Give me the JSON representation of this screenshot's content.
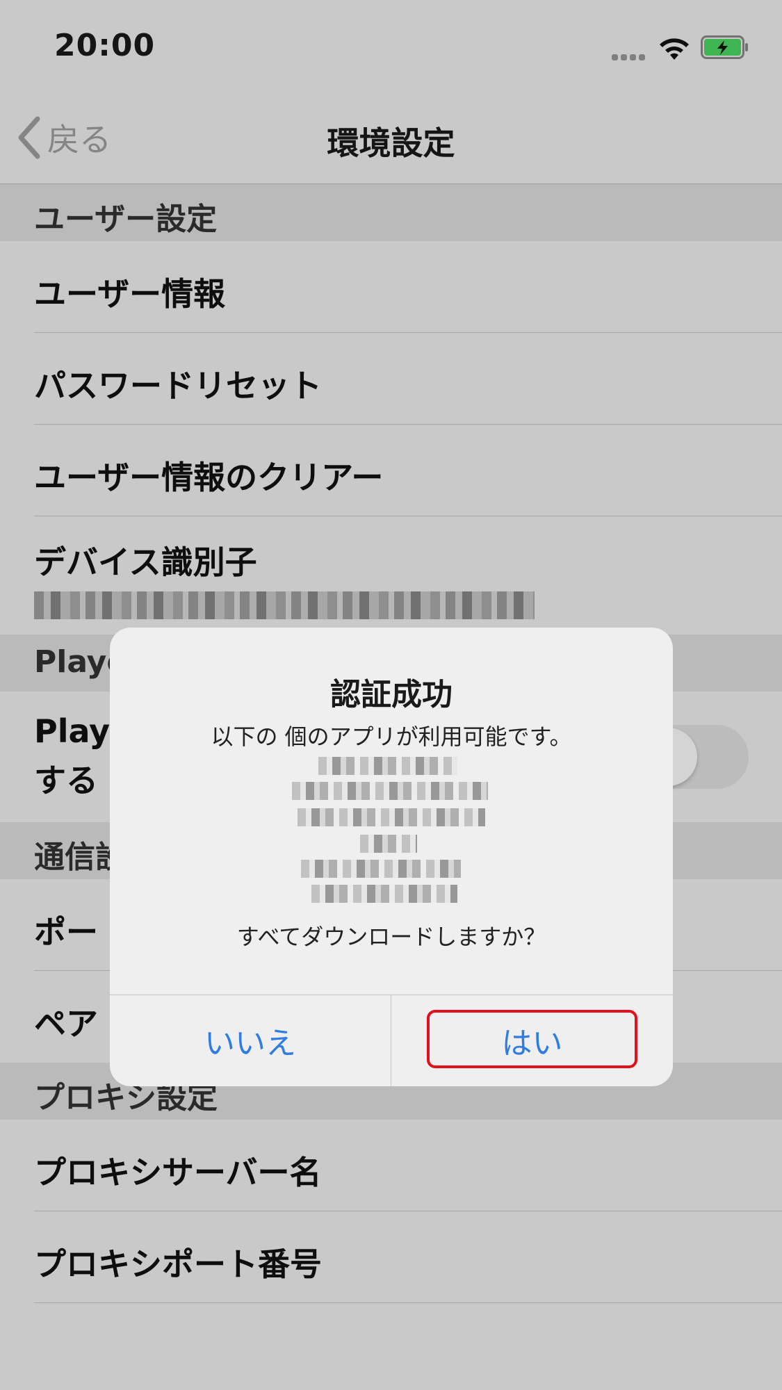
{
  "status_bar": {
    "time": "20:00"
  },
  "nav": {
    "back_label": "戻る",
    "title": "環境設定"
  },
  "sections": {
    "user": {
      "header": "ユーザー設定",
      "items": [
        "ユーザー情報",
        "パスワードリセット",
        "ユーザー情報のクリアー",
        "デバイス識別子"
      ]
    },
    "player": {
      "header_partial": "Playe",
      "item_line1": "Playe",
      "item_line2": "する"
    },
    "comm": {
      "header_partial": "通信設",
      "item1_partial": "ポー",
      "item2_partial": "ペア"
    },
    "proxy": {
      "header": "プロキシ設定",
      "items": [
        "プロキシサーバー名",
        "プロキシポート番号"
      ]
    }
  },
  "alert": {
    "title": "認証成功",
    "message": "以下の  個のアプリが利用可能です。",
    "question": "すべてダウンロードしますか？",
    "no_label": "いいえ",
    "yes_label": "はい"
  },
  "colors": {
    "accent": "#2f7de1",
    "highlight": "#e0111a",
    "battery": "#4cd964"
  },
  "icons": {
    "back": "chevron-left-icon",
    "wifi": "wifi-icon",
    "battery": "battery-charging-icon",
    "signal": "signal-icon"
  }
}
